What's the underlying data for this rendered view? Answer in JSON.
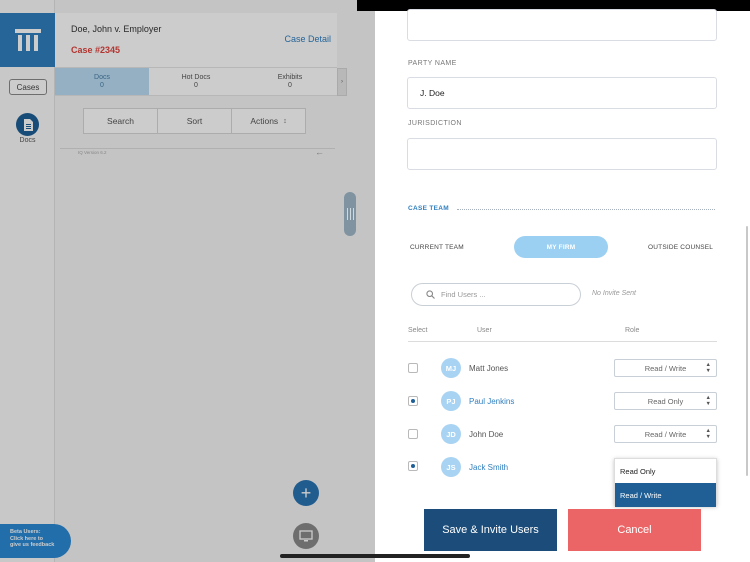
{
  "rail": {
    "cases_label": "Cases",
    "docs_label": "Docs"
  },
  "case": {
    "name": "Doe, John v. Employer",
    "number": "Case #2345",
    "detail_link": "Case Detail"
  },
  "segments": [
    {
      "label": "Docs",
      "count": "0"
    },
    {
      "label": "Hot Docs",
      "count": "0"
    },
    {
      "label": "Exhibits",
      "count": "0"
    }
  ],
  "tools": {
    "search": "Search",
    "sort": "Sort",
    "actions": "Actions"
  },
  "version_text": "IQ Version 6.2",
  "beta": {
    "line1": "Beta Users:",
    "line2": "Click here to",
    "line3": "give us feedback"
  },
  "form": {
    "party_name_label": "PARTY NAME",
    "party_name_value": "J. Doe",
    "jurisdiction_label": "JURISDICTION",
    "jurisdiction_value": ""
  },
  "team": {
    "title": "CASE TEAM",
    "tabs": [
      "CURRENT TEAM",
      "MY FIRM",
      "OUTSIDE COUNSEL"
    ],
    "active_tab": "MY FIRM",
    "search_placeholder": "Find Users ...",
    "no_invite": "No Invite Sent",
    "columns": [
      "Select",
      "User",
      "Role"
    ],
    "users": [
      {
        "initials": "MJ",
        "name": "Matt Jones",
        "role": "Read / Write",
        "selected": false
      },
      {
        "initials": "PJ",
        "name": "Paul Jenkins",
        "role": "Read Only",
        "selected": true
      },
      {
        "initials": "JD",
        "name": "John Doe",
        "role": "Read / Write",
        "selected": false
      },
      {
        "initials": "JS",
        "name": "Jack Smith",
        "role": "",
        "selected": true
      }
    ],
    "role_options": [
      "Read Only",
      "Read / Write"
    ],
    "role_highlighted": "Read / Write"
  },
  "buttons": {
    "save": "Save & Invite Users",
    "cancel": "Cancel"
  },
  "colors": {
    "primary": "#1c4d7a",
    "accent_blue": "#2f7fbf",
    "cancel_red": "#ec6566",
    "case_red": "#e0433d",
    "tab_active": "#9bd0f2"
  }
}
